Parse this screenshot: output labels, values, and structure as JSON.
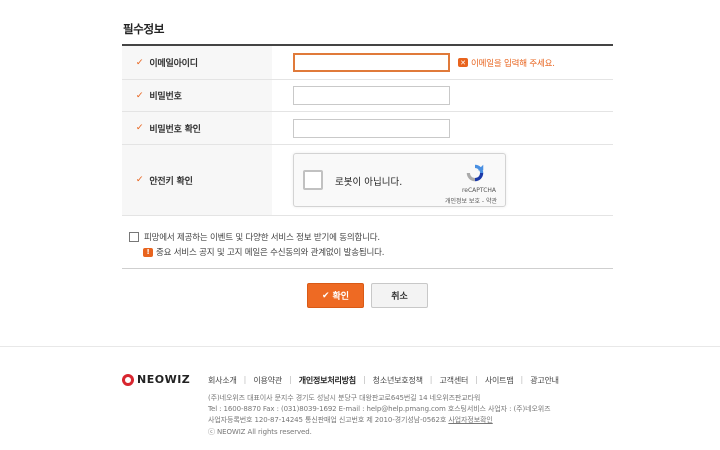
{
  "section_title": "필수정보",
  "form": {
    "rows": [
      {
        "label": "이메일아이디",
        "value": "",
        "placeholder": ""
      },
      {
        "label": "비밀번호",
        "value": "",
        "placeholder": ""
      },
      {
        "label": "비밀번호 확인",
        "value": "",
        "placeholder": ""
      },
      {
        "label": "안전키 확인"
      }
    ],
    "email_error": "이메일을 입력해 주세요.",
    "error_icon": "warning-icon",
    "chevron_icon": "chevron-down-icon"
  },
  "recaptcha": {
    "label": "로봇이 아닙니다.",
    "brand": "reCAPTCHA",
    "links": "개인정보 보호 - 약관"
  },
  "agreement": {
    "text": "피망에서 제공하는 이벤트 및 다양한 서비스 정보 받기에 동의합니다.",
    "note": "중요 서비스 공지 및 고지 메일은 수신동의와 관계없이 발송됩니다.",
    "checked": false
  },
  "buttons": {
    "confirm": "확인",
    "cancel": "취소"
  },
  "footer": {
    "logo": "NEOWIZ",
    "links": [
      "회사소개",
      "이용약관",
      "개인정보처리방침",
      "청소년보호정책",
      "고객센터",
      "사이트맵",
      "광고안내"
    ],
    "info_line1": "(주)네오위즈 대표이사 문지수 경기도 성남시 분당구 대왕판교로645번길 14 네오위즈판교타워",
    "info_line2": "Tel : 1600-8870  Fax : (031)8039-1692  E-mail : help@help.pmang.com  호스팅서비스 사업자 : (주)네오위즈",
    "info_line3_prefix": "사업자등록번호 120-87-14245 통신판매업 신고번호 제 2010-경기성남-0562호",
    "info_line3_link": "사업자정보확인",
    "copyright": "ⓒ NEOWIZ All rights reserved."
  },
  "colors": {
    "accent": "#ee6a23",
    "error": "#e8641e",
    "logo_red": "#d8262f"
  }
}
